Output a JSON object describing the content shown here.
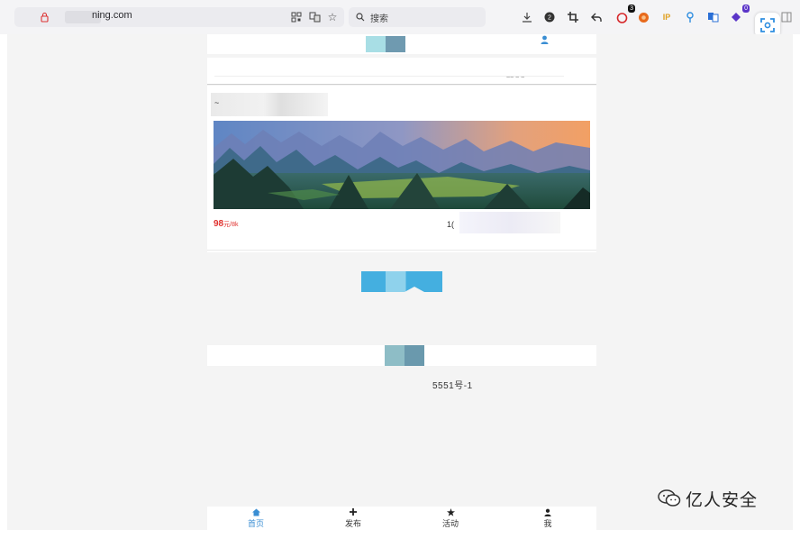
{
  "browser": {
    "url_text": "ning.com",
    "search_placeholder": "搜索",
    "extension_badges": {
      "first": "3",
      "second": "0"
    },
    "ip_label": "IP"
  },
  "page": {
    "band_mark": "~~ ~ ~",
    "title_dash": "~",
    "listing": {
      "price": "98",
      "price_unit": "元",
      "price_suffix": "/8k",
      "meta": "1("
    },
    "icp": "5551号-1"
  },
  "tabbar": {
    "items": [
      {
        "label": "首页",
        "icon": "home-icon",
        "active": true
      },
      {
        "label": "发布",
        "icon": "plus-icon",
        "active": false
      },
      {
        "label": "活动",
        "icon": "star-icon",
        "active": false
      },
      {
        "label": "我",
        "icon": "user-icon",
        "active": false
      }
    ]
  },
  "watermark": {
    "text": "亿人安全"
  },
  "colors": {
    "accent": "#3a8ed3",
    "price": "#e0322f",
    "button": "#44afe0"
  }
}
